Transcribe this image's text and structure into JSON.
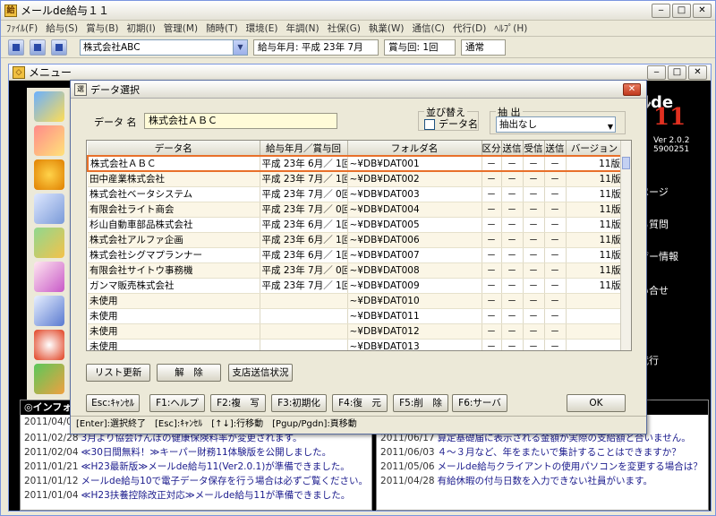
{
  "app": {
    "title": "メールde給与１１",
    "menus": [
      "ﾌｧｲﾙ(F)",
      "給与(S)",
      "賞与(B)",
      "初期(I)",
      "管理(M)",
      "随時(T)",
      "環境(E)",
      "年調(N)",
      "社保(G)",
      "執業(W)",
      "通信(C)",
      "代行(D)",
      "ﾍﾙﾌﾟ(H)"
    ],
    "toolbar": {
      "company": "株式会社ABC",
      "pay_month": "給与年月: 平成 23年 7月",
      "bonus": "賞与回: 1回",
      "mode": "通常"
    }
  },
  "menu_window": {
    "title": "メニュー",
    "brand": "ﾙde",
    "brand_num": "11",
    "version": "Ver 2.0.2",
    "version_no": "5900251",
    "right_links": [
      "ページ",
      "る質問",
      "ザー情報",
      "い合せ",
      "代行"
    ],
    "info_title": "◎インフォ",
    "news_left": [
      {
        "date": "2011/04/0",
        "text": ""
      },
      {
        "date": "2011/02/28",
        "text": "3月より協会けんぽの健康保険料率が変更されます。"
      },
      {
        "date": "2011/02/04",
        "text": "≪30日間無料！≫キーパー財務11体験版を公開しました。"
      },
      {
        "date": "2011/01/21",
        "text": "≪H23最新版≫メールde給与11(Ver2.0.1)が準備できました。"
      },
      {
        "date": "2011/01/12",
        "text": "メールde給与10で電子データ保存を行う場合は必ずご覧ください。"
      },
      {
        "date": "2011/01/04",
        "text": "≪H23扶養控除改正対応≫メールde給与11が準備できました。"
      }
    ],
    "news_right": [
      {
        "date": "2011/06/30",
        "text": "賞与の個人一覧表や金種表が作成できません。"
      },
      {
        "date": "2011/06/17",
        "text": "算定基礎届に表示される金額が実際の支給額と合いません。"
      },
      {
        "date": "2011/06/03",
        "text": "４～３月など、年をまたいで集計することはできますか？"
      },
      {
        "date": "2011/05/06",
        "text": "メールde給与クライアントの使用パソコンを変更する場合は？"
      },
      {
        "date": "2011/04/28",
        "text": "有給休暇の付与日数を入力できない社員がいます。"
      }
    ]
  },
  "dialog": {
    "title": "データ選択",
    "data_name_label": "データ 名",
    "data_name_value": "株式会社ＡＢＣ",
    "sort_label": "並び替え",
    "sort_checkbox_label": "データ名",
    "extract_label": "抽 出",
    "extract_value": "抽出なし",
    "columns": [
      "データ名",
      "給与年月／賞与回",
      "フォルダ名",
      "区分",
      "送信",
      "受信",
      "送信",
      "バージョン"
    ],
    "rows": [
      [
        "株式会社ＡＢＣ",
        "平成 23年 6月／ 1回",
        "~¥DB¥DAT001",
        "－",
        "－",
        "－",
        "－",
        "11版"
      ],
      [
        "田中産業株式会社",
        "平成 23年 7月／ 1回",
        "~¥DB¥DAT002",
        "－",
        "－",
        "－",
        "－",
        "11版"
      ],
      [
        "株式会社ベータシステム",
        "平成 23年 7月／ 0回",
        "~¥DB¥DAT003",
        "－",
        "－",
        "－",
        "－",
        "11版"
      ],
      [
        "有限会社ライト商会",
        "平成 23年 7月／ 0回",
        "~¥DB¥DAT004",
        "－",
        "－",
        "－",
        "－",
        "11版"
      ],
      [
        "杉山自動車部品株式会社",
        "平成 23年 6月／ 1回",
        "~¥DB¥DAT005",
        "－",
        "－",
        "－",
        "－",
        "11版"
      ],
      [
        "株式会社アルファ企画",
        "平成 23年 6月／ 1回",
        "~¥DB¥DAT006",
        "－",
        "－",
        "－",
        "－",
        "11版"
      ],
      [
        "株式会社シグマプランナー",
        "平成 23年 6月／ 1回",
        "~¥DB¥DAT007",
        "－",
        "－",
        "－",
        "－",
        "11版"
      ],
      [
        "有限会社サイトウ事務機",
        "平成 23年 7月／ 0回",
        "~¥DB¥DAT008",
        "－",
        "－",
        "－",
        "－",
        "11版"
      ],
      [
        "ガンマ販売株式会社",
        "平成 23年 7月／ 1回",
        "~¥DB¥DAT009",
        "－",
        "－",
        "－",
        "－",
        "11版"
      ],
      [
        "未使用",
        "",
        "~¥DB¥DAT010",
        "－",
        "－",
        "－",
        "－",
        ""
      ],
      [
        "未使用",
        "",
        "~¥DB¥DAT011",
        "－",
        "－",
        "－",
        "－",
        ""
      ],
      [
        "未使用",
        "",
        "~¥DB¥DAT012",
        "－",
        "－",
        "－",
        "－",
        ""
      ],
      [
        "未使用",
        "",
        "~¥DB¥DAT013",
        "－",
        "－",
        "－",
        "－",
        ""
      ]
    ],
    "buttons_mid": [
      "リスト更新",
      "解　除",
      "支店送信状況"
    ],
    "buttons_bottom": [
      "Esc:ｷｬﾝｾﾙ",
      "F1:ヘルプ",
      "F2:複　写",
      "F3:初期化",
      "F4:復　元",
      "F5:削　除",
      "F6:サーバ",
      "OK"
    ],
    "status": "[Enter]:選択終了　[Esc]:ｷｬﾝｾﾙ　[↑↓]:行移動　[Pgup/Pgdn]:頁移動"
  }
}
